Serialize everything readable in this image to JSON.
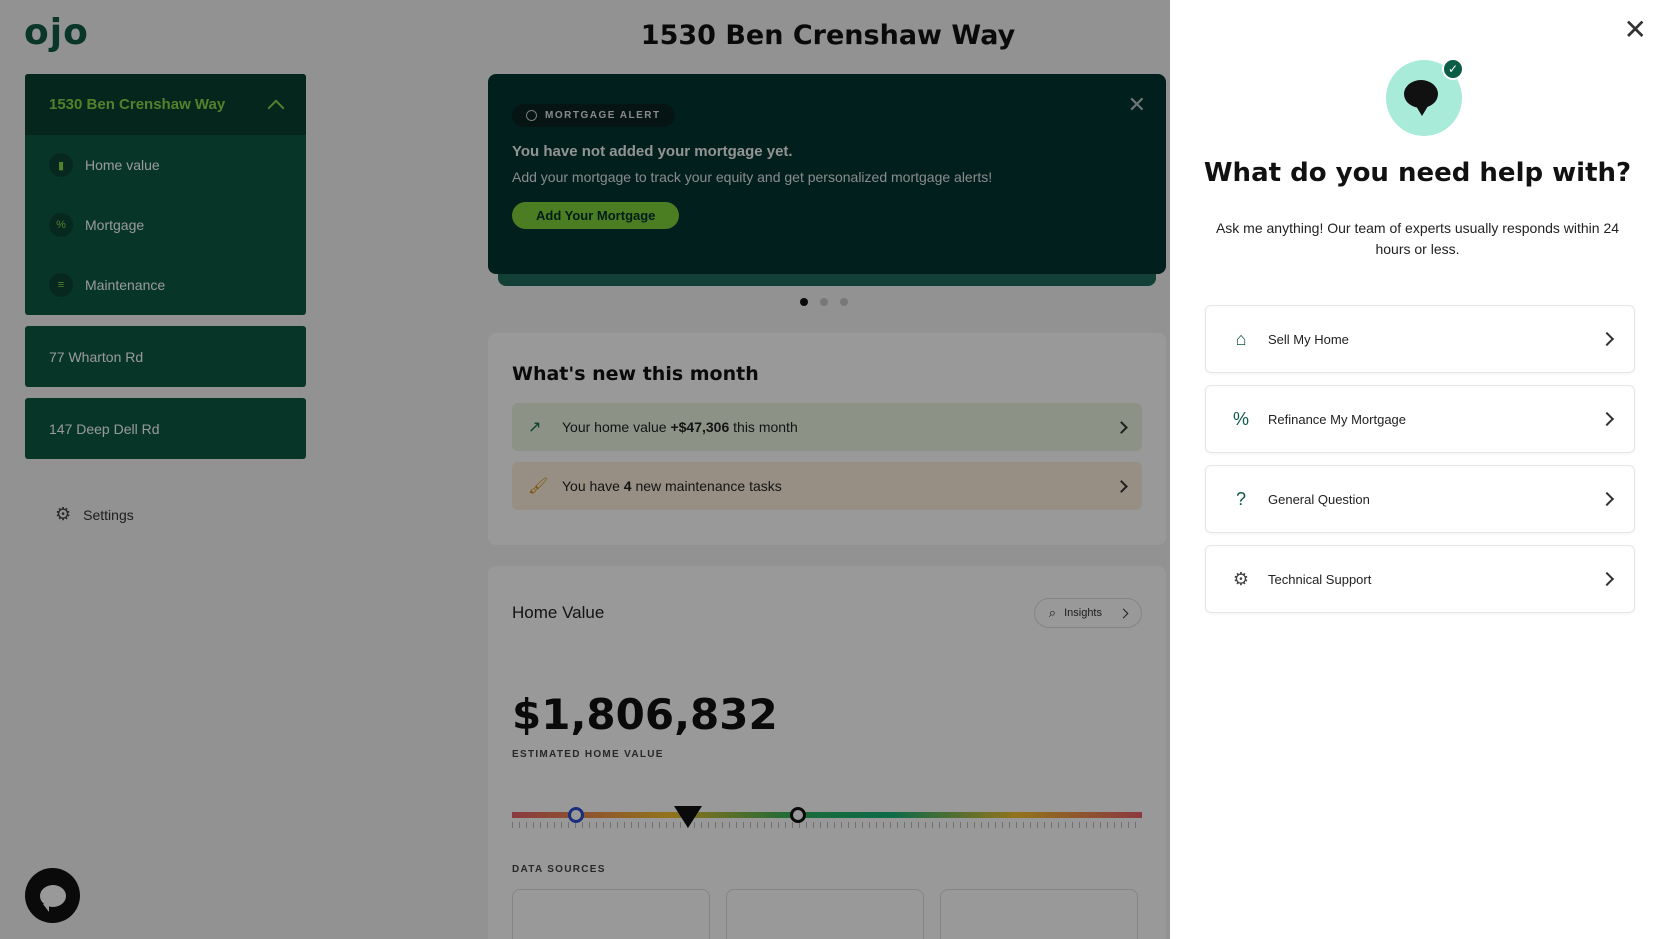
{
  "app": {
    "logo": "ojo",
    "page_title": "1530 Ben Crenshaw Way"
  },
  "sidebar": {
    "active_property": "1530 Ben Crenshaw Way",
    "sub_items": [
      {
        "label": "Home value",
        "icon": "bar-chart-icon"
      },
      {
        "label": "Mortgage",
        "icon": "percent-icon"
      },
      {
        "label": "Maintenance",
        "icon": "list-icon"
      }
    ],
    "properties": [
      "77 Wharton Rd",
      "147 Deep Dell Rd"
    ],
    "settings_label": "Settings"
  },
  "alert": {
    "badge": "MORTGAGE ALERT",
    "title": "You have not added your mortgage yet.",
    "text": "Add your mortgage to track your equity and get personalized mortgage alerts!",
    "button": "Add Your Mortgage"
  },
  "carousel": {
    "total": 3,
    "active": 1
  },
  "whats_new": {
    "title": "What's new this month",
    "home_value_prefix": "Your home value ",
    "home_value_change": "+$47,306",
    "home_value_suffix": " this month",
    "tasks_prefix": "You have ",
    "tasks_count": "4",
    "tasks_suffix": " new maintenance tasks"
  },
  "home_value": {
    "title": "Home Value",
    "insights_label": "Insights",
    "value": "$1,806,832",
    "value_label": "ESTIMATED HOME VALUE",
    "data_sources_label": "DATA SOURCES"
  },
  "help_panel": {
    "title": "What do you need help with?",
    "subtitle": "Ask me anything! Our team of experts usually responds within 24 hours or less.",
    "options": [
      {
        "label": "Sell My Home",
        "icon": "house-icon"
      },
      {
        "label": "Refinance My Mortgage",
        "icon": "percent-icon"
      },
      {
        "label": "General Question",
        "icon": "question-icon"
      },
      {
        "label": "Technical Support",
        "icon": "gear-icon"
      }
    ]
  },
  "colors": {
    "brand_green": "#0d5a45",
    "accent_lime": "#7dd23a",
    "alert_bg": "#003431"
  }
}
